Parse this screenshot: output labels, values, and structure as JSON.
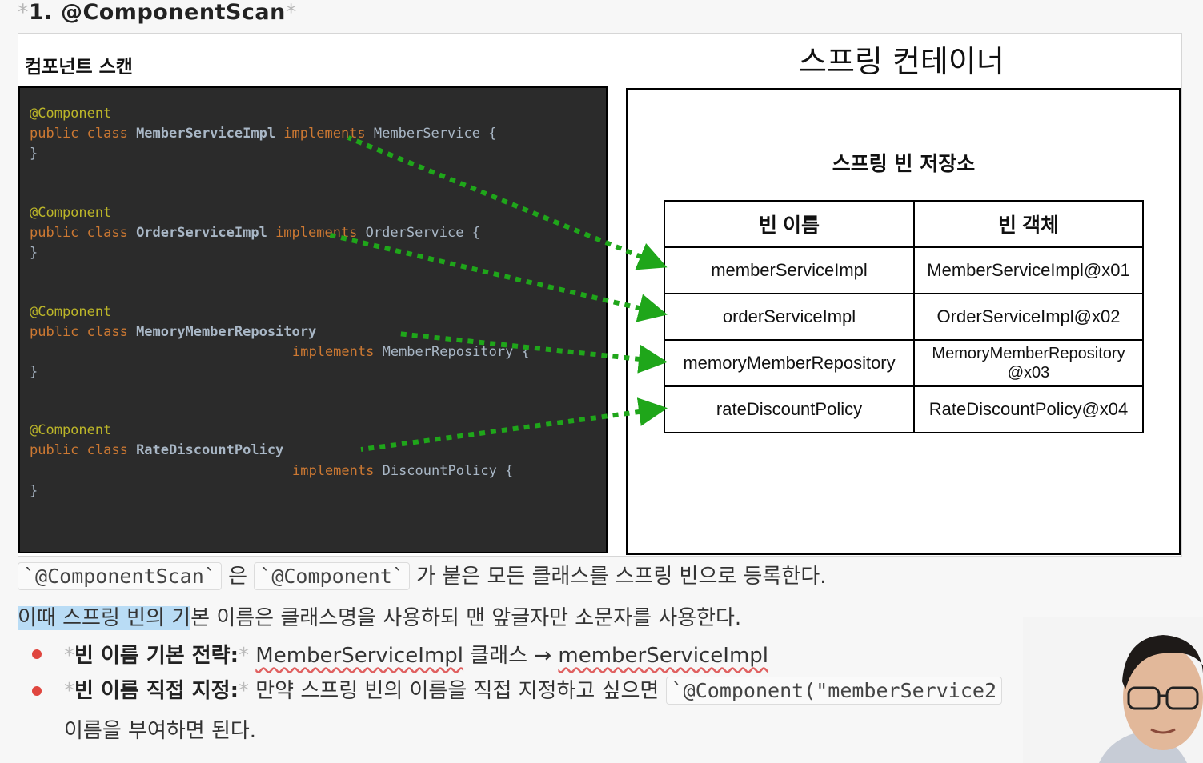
{
  "heading": {
    "star_left": "*",
    "text": "1. @ComponentScan",
    "star_right": "*"
  },
  "slide": {
    "scan_label": "컴포넌트 스캔",
    "container_title": "스프링 컨테이너",
    "code": {
      "block1": {
        "annotation": "@Component",
        "kw": "public class ",
        "class_name": "MemberServiceImpl",
        "rest": " implements ",
        "iface": "MemberService {",
        "close": "}"
      },
      "block2": {
        "annotation": "@Component",
        "kw": "public class ",
        "class_name": "OrderServiceImpl",
        "rest": " implements ",
        "iface": "OrderService {",
        "close": "}"
      },
      "block3": {
        "annotation": "@Component",
        "kw": "public class ",
        "class_name": "MemoryMemberRepository",
        "rest": "implements ",
        "iface": "MemberRepository {",
        "close": "}"
      },
      "block4": {
        "annotation": "@Component",
        "kw": "public class ",
        "class_name": "RateDiscountPolicy",
        "rest": "implements ",
        "iface": "DiscountPolicy {",
        "close": "}"
      }
    },
    "store_title": "스프링 빈 저장소",
    "table": {
      "headers": [
        "빈 이름",
        "빈 객체"
      ],
      "rows": [
        [
          "memberServiceImpl",
          "MemberServiceImpl@x01"
        ],
        [
          "orderServiceImpl",
          "OrderServiceImpl@x02"
        ],
        [
          "memoryMemberRepository",
          "MemoryMemberRepository\n@x03"
        ],
        [
          "rateDiscountPolicy",
          "RateDiscountPolicy@x04"
        ]
      ]
    },
    "arrow_color": "#1fa61a"
  },
  "body": {
    "line1": {
      "chip1": "`@ComponentScan`",
      "t1": " 은 ",
      "chip2": "`@Component`",
      "t2": " 가 붙은 모든 클래스를 스프링 빈으로 등록한다."
    },
    "line2": {
      "highlight": "이때 스프링 빈의 기",
      "rest": "본 이름은 클래스명을 사용하되 맨 앞글자만 소문자를 사용한다."
    },
    "bullet1": {
      "star": "*",
      "label": "빈 이름 기본 전략:",
      "star2": "*",
      "t1": " ",
      "u1": "MemberServiceImpl",
      "t2": " 클래스 → ",
      "u2": "memberServiceImpl"
    },
    "bullet2": {
      "star": "*",
      "label": "빈 이름 직접 지정:",
      "star2": "*",
      "t1": " 만약 스프링 빈의 이름을 직접 지정하고 싶으면 ",
      "chip": "`@Component(\"memberService2",
      "cont": "이름을 부여하면 된다."
    }
  }
}
